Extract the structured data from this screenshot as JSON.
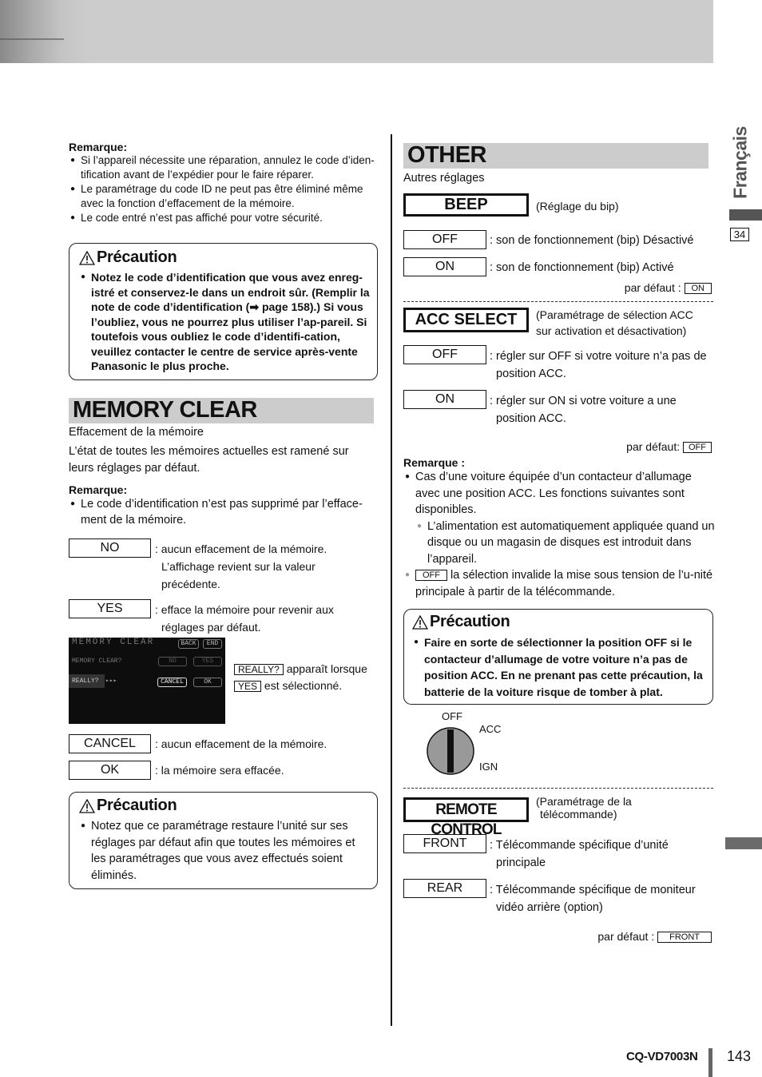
{
  "side_tab": {
    "language": "Français",
    "section_number": "34"
  },
  "footer": {
    "model": "CQ-VD7003N",
    "page_number": "143"
  },
  "left": {
    "remark1": {
      "title": "Remarque:",
      "items": [
        "Si l’appareil nécessite une réparation, annulez le code d’iden-tification avant de l’expédier pour le faire réparer.",
        "Le paramétrage du code ID ne peut pas être éliminé même avec la fonction d’effacement de la mémoire.",
        "Le code entré n’est pas affiché pour votre sécurité."
      ]
    },
    "caution1": {
      "title": "Précaution",
      "text": "Notez le code d’identification que vous avez enreg-istré et conservez-le dans un endroit sûr. (Remplir la note de code d’identification (➡ page 158).) Si vous l’oubliez, vous ne pourrez plus utiliser l’ap-pareil. Si toutefois vous oubliez le code d’identifi-cation, veuillez contacter le centre de service après-vente Panasonic le plus proche."
    },
    "memory_clear": {
      "heading": "MEMORY CLEAR",
      "subtitle": "Effacement de la mémoire",
      "description": "L’état de toutes les mémoires actuelles est ramené sur leurs réglages par défaut.",
      "remark_title": "Remarque:",
      "remark_items": [
        "Le code d’identification n’est pas supprimé par l’efface-ment de la mémoire."
      ],
      "options": [
        {
          "label": "NO",
          "desc": ": aucun effacement de la mémoire. L’affichage revient sur la valeur précédente."
        },
        {
          "label": "YES",
          "desc": ": efface la mémoire pour revenir aux réglages par défaut."
        }
      ],
      "screen": {
        "title": "MEMORY CLEAR",
        "back": "BACK",
        "end": "END",
        "question": "MEMORY CLEAR?",
        "no": "NO",
        "yes": "YES",
        "really": "REALLY?",
        "arrows": "▸▸▸",
        "cancel": "CANCEL",
        "ok": "OK"
      },
      "screen_note": {
        "box1": "REALLY?",
        "text1": "apparaît lorsque",
        "box2": "YES",
        "text2": "est sélectionné."
      },
      "confirm_options": [
        {
          "label": "CANCEL",
          "desc": ": aucun effacement de la mémoire."
        },
        {
          "label": "OK",
          "desc": ": la mémoire sera effacée."
        }
      ]
    },
    "caution2": {
      "title": "Précaution",
      "text": "Notez que ce paramétrage restaure l’unité sur ses réglages par défaut afin que toutes les mémoires et les paramétrages que vous avez effectués soient éliminés."
    }
  },
  "right": {
    "other": {
      "heading": "OTHER",
      "subtitle": "Autres réglages"
    },
    "beep": {
      "label": "BEEP",
      "note": "(Réglage du bip)",
      "options": [
        {
          "label": "OFF",
          "desc": ": son de fonctionnement (bip) Désactivé"
        },
        {
          "label": "ON",
          "desc": ": son de fonctionnement (bip) Activé"
        }
      ],
      "default_label": "par défaut :",
      "default_value": "ON"
    },
    "acc_select": {
      "label": "ACC SELECT",
      "note": "(Paramétrage de sélection ACC sur activation et désactivation)",
      "options": [
        {
          "label": "OFF",
          "desc": ": régler sur OFF si votre voiture n’a pas de position ACC."
        },
        {
          "label": "ON",
          "desc": ": régler sur ON si votre voiture a une position ACC."
        }
      ],
      "default_label": "par défaut:",
      "default_value": "OFF",
      "remark_title": "Remarque :",
      "remark_item1": "Cas d’une voiture équipée d’un contacteur d’allumage avec une position ACC. Les fonctions suivantes sont disponibles.",
      "remark_sub": "L’alimentation est automatiquement appliquée quand un disque ou un magasin de disques est introduit dans l’appareil.",
      "remark_item2_box": "OFF",
      "remark_item2": "la sélection invalide la mise sous tension de l’u-nité principale à partir de la télécommande."
    },
    "caution3": {
      "title": "Précaution",
      "text": "Faire en sorte de sélectionner la position OFF si le contacteur d’allumage de votre voiture n’a pas de position ACC. En ne prenant pas cette précaution, la batterie de la voiture risque de tomber à plat."
    },
    "ignition": {
      "off": "OFF",
      "acc": "ACC",
      "ign": "IGN"
    },
    "remote": {
      "label": "REMOTE CONTROL",
      "note_line1": "(Paramétrage de la",
      "note_line2": "télécommande)",
      "options": [
        {
          "label": "FRONT",
          "desc": ": Télécommande spécifique d’unité principale"
        },
        {
          "label": "REAR",
          "desc": ": Télécommande spécifique de moniteur vidéo arrière (option)"
        }
      ],
      "default_label": "par défaut :",
      "default_value": "FRONT"
    }
  }
}
